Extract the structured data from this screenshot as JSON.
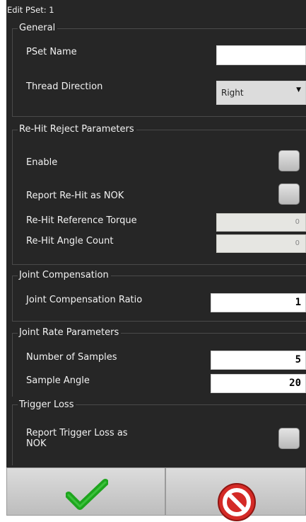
{
  "title": "Edit PSet: 1",
  "sections": {
    "general": {
      "legend": "General",
      "pset_name_label": "PSet Name",
      "pset_name_value": "",
      "thread_direction_label": "Thread Direction",
      "thread_direction_value": "Right"
    },
    "rehit": {
      "legend": "Re-Hit Reject Parameters",
      "enable_label": "Enable",
      "enable_checked": false,
      "report_label": "Report Re-Hit as NOK",
      "report_checked": false,
      "ref_torque_label": "Re-Hit Reference Torque",
      "ref_torque_value": "0",
      "angle_count_label": "Re-Hit Angle Count",
      "angle_count_value": "0"
    },
    "joint_comp": {
      "legend": "Joint Compensation",
      "ratio_label": "Joint Compensation Ratio",
      "ratio_value": "1"
    },
    "joint_rate": {
      "legend": "Joint Rate Parameters",
      "samples_label": "Number of Samples",
      "samples_value": "5",
      "angle_label": "Sample Angle",
      "angle_value": "20"
    },
    "trigger_loss": {
      "legend": "Trigger Loss",
      "report_label_line1": "Report Trigger Loss as",
      "report_label_line2": "NOK",
      "report_checked": false
    }
  },
  "footer": {
    "confirm_icon": "checkmark-icon",
    "cancel_icon": "no-entry-icon"
  },
  "colors": {
    "panel_bg": "#262626",
    "confirm": "#1ea51e",
    "cancel": "#d42a26"
  }
}
